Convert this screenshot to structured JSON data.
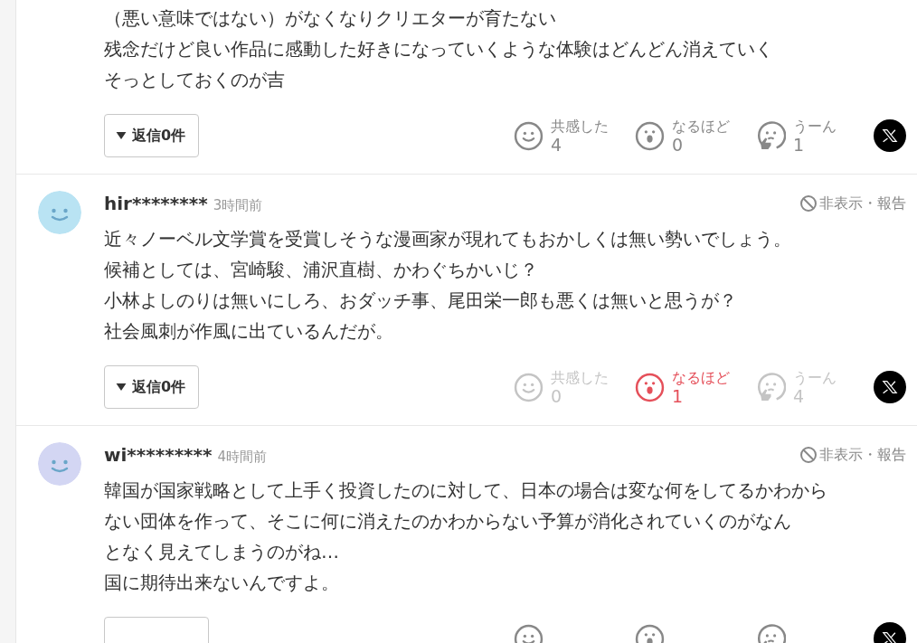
{
  "comments": [
    {
      "lines": [
        "（悪い意味ではない）がなくなりクリエターが育たない",
        "残念だけど良い作品に感動した好きになっていくような体験はどんどん消えていく",
        "そっとしておくのが吉"
      ],
      "reply_button": "返信0件",
      "reactions": [
        {
          "kind": "empathy",
          "label": "共感した",
          "count": "4",
          "selected": false
        },
        {
          "kind": "insight",
          "label": "なるほど",
          "count": "0",
          "selected": false
        },
        {
          "kind": "doubt",
          "label": "うーん",
          "count": "1",
          "selected": false
        }
      ]
    },
    {
      "user": "hir********",
      "time": "3時間前",
      "hide_report": "非表示・報告",
      "lines": [
        "近々ノーベル文学賞を受賞しそうな漫画家が現れてもおかしくは無い勢いでしょう。",
        "候補としては、宮崎駿、浦沢直樹、かわぐちかいじ？",
        "小林よしのりは無いにしろ、おダッチ事、尾田栄一郎も悪くは無いと思うが？",
        "社会風刺が作風に出ているんだが。"
      ],
      "reply_button": "返信0件",
      "reactions": [
        {
          "kind": "empathy",
          "label": "共感した",
          "count": "0",
          "selected": false
        },
        {
          "kind": "insight",
          "label": "なるほど",
          "count": "1",
          "selected": true
        },
        {
          "kind": "doubt",
          "label": "うーん",
          "count": "4",
          "selected": false
        }
      ]
    },
    {
      "user": "wi*********",
      "time": "4時間前",
      "hide_report": "非表示・報告",
      "lines": [
        "韓国が国家戦略として上手く投資したのに対して、日本の場合は変な何をしてるかわから",
        "ない団体を作って、そこに何に消えたのかわからない予算が消化されていくのがなん",
        "となく見えてしまうのがね…",
        "国に期待出来ないんですよ。"
      ],
      "reactions": [
        {
          "kind": "empathy",
          "selected": false
        },
        {
          "kind": "insight",
          "selected": false
        },
        {
          "kind": "doubt",
          "selected": false
        }
      ]
    }
  ]
}
